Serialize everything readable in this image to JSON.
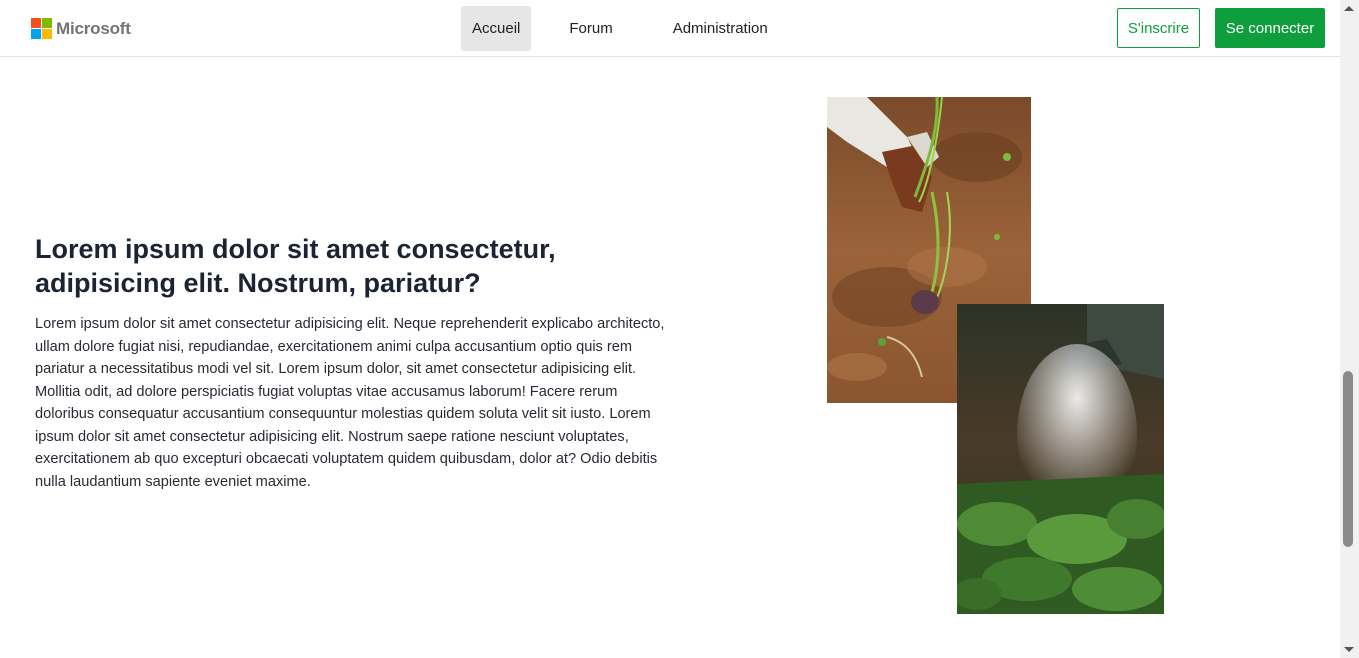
{
  "header": {
    "logo_text": "Microsoft",
    "logo_colors": [
      "#f25022",
      "#7fba00",
      "#00a4ef",
      "#ffb900"
    ],
    "nav": [
      {
        "label": "Accueil",
        "active": true
      },
      {
        "label": "Forum",
        "active": false
      },
      {
        "label": "Administration",
        "active": false
      }
    ],
    "signup_label": "S'inscrire",
    "login_label": "Se connecter",
    "accent_color": "#0e9f3c"
  },
  "hero": {
    "headline": "Lorem ipsum dolor sit amet consectetur, adipisicing elit. Nostrum, pariatur?",
    "paragraph": "Lorem ipsum dolor sit amet consectetur adipisicing elit. Neque reprehenderit explicabo architecto, ullam dolore fugiat nisi, repudiandae, exercitationem animi culpa accusantium optio quis rem pariatur a necessitatibus modi vel sit. Lorem ipsum dolor, sit amet consectetur adipisicing elit. Mollitia odit, ad dolore perspiciatis fugiat voluptas vitae accusamus laborum! Facere rerum doloribus consequatur accusantium consequuntur molestias quidem soluta velit sit iusto. Lorem ipsum dolor sit amet consectetur adipisicing elit. Nostrum saepe ratione nesciunt voluptates, exercitationem ab quo excepturi obcaecati voluptatem quidem quibusdam, dolor at? Odio debitis nulla laudantium sapiente eveniet maxime."
  }
}
